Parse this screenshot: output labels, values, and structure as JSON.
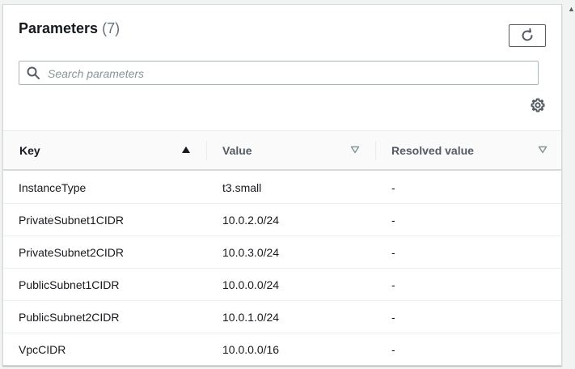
{
  "header": {
    "title": "Parameters",
    "count": "(7)"
  },
  "search": {
    "placeholder": "Search parameters",
    "value": ""
  },
  "icons": {
    "refresh": "refresh-icon",
    "search": "search-icon",
    "settings": "gear-icon",
    "sort_asc": "caret-up-icon",
    "sort_none": "caret-down-outline-icon"
  },
  "table": {
    "columns": {
      "key": "Key",
      "value": "Value",
      "resolved": "Resolved value"
    },
    "sorted_by": "Key",
    "sort_direction": "ascending",
    "rows": [
      {
        "key": "InstanceType",
        "value": "t3.small",
        "resolved": "-"
      },
      {
        "key": "PrivateSubnet1CIDR",
        "value": "10.0.2.0/24",
        "resolved": "-"
      },
      {
        "key": "PrivateSubnet2CIDR",
        "value": "10.0.3.0/24",
        "resolved": "-"
      },
      {
        "key": "PublicSubnet1CIDR",
        "value": "10.0.0.0/24",
        "resolved": "-"
      },
      {
        "key": "PublicSubnet2CIDR",
        "value": "10.0.1.0/24",
        "resolved": "-"
      },
      {
        "key": "VpcCIDR",
        "value": "10.0.0.0/16",
        "resolved": "-"
      }
    ]
  },
  "colors": {
    "text": "#16191f",
    "muted": "#687078",
    "border": "#d5dbdb"
  }
}
